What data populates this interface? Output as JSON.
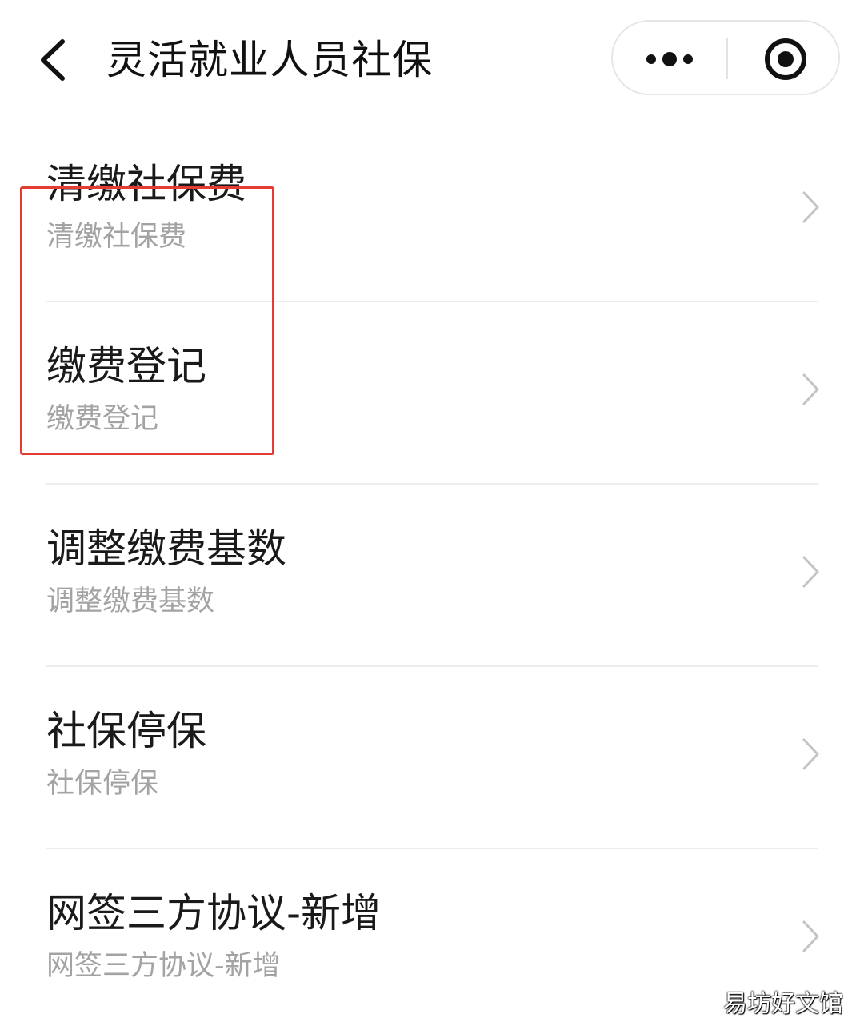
{
  "navbar": {
    "title": "灵活就业人员社保",
    "back_icon": "chevron-left-icon",
    "more_icon": "more-dots-icon",
    "close_icon": "target-circle-icon"
  },
  "menu": {
    "items": [
      {
        "title": "清缴社保费",
        "subtitle": "清缴社保费"
      },
      {
        "title": "缴费登记",
        "subtitle": "缴费登记"
      },
      {
        "title": "调整缴费基数",
        "subtitle": "调整缴费基数"
      },
      {
        "title": "社保停保",
        "subtitle": "社保停保"
      },
      {
        "title": "网签三方协议-新增",
        "subtitle": "网签三方协议-新增"
      }
    ]
  },
  "highlight": {
    "color": "#e53b35"
  },
  "watermark": {
    "text": "易坊好文馆"
  }
}
